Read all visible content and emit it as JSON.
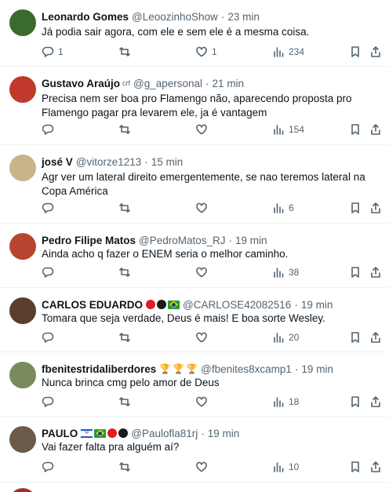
{
  "tweets": [
    {
      "name": "Leonardo Gomes",
      "handle": "@LeoozinhoShow",
      "sep": "·",
      "time": "23 min",
      "text": "Já podia sair agora, com ele e sem ele é a mesma coisa.",
      "replies": "1",
      "retweets": "",
      "likes": "1",
      "views": "234",
      "avatar_color": "#3a6b2e"
    },
    {
      "name": "Gustavo Araújo",
      "badge": "crf",
      "handle": "@g_apersonal",
      "sep": "·",
      "time": "21 min",
      "text": "Precisa nem ser boa pro Flamengo não, aparecendo proposta pro Flamengo pagar pra levarem ele, ja é vantagem",
      "replies": "",
      "retweets": "",
      "likes": "",
      "views": "154",
      "avatar_color": "#c0392b"
    },
    {
      "name": "josé V",
      "handle": "@vitorze1213",
      "sep": "·",
      "time": "15 min",
      "text": "Agr ver um lateral direito emergentemente, se nao teremos lateral na Copa América",
      "replies": "",
      "retweets": "",
      "likes": "",
      "views": "6",
      "avatar_color": "#c9b48a"
    },
    {
      "name": "Pedro Filipe Matos",
      "handle": "@PedroMatos_RJ",
      "sep": "·",
      "time": "19 min",
      "text": "Ainda acho q fazer o ENEM seria o melhor caminho.",
      "replies": "",
      "retweets": "",
      "likes": "",
      "views": "38",
      "avatar_color": "#b8452f"
    },
    {
      "name": "CARLOS EDUARDO",
      "handle": "@CARLOSE42082516",
      "sep": "·",
      "time": "19 min",
      "text": "Tomara que seja verdade, Deus é mais! E boa sorte Wesley.",
      "replies": "",
      "retweets": "",
      "likes": "",
      "views": "20",
      "avatar_color": "#5a3d2b"
    },
    {
      "name": "fbenitestridaliberdores",
      "handle": "@fbenites8xcamp1",
      "sep": "·",
      "time": "19 min",
      "text": "Nunca brinca cmg pelo amor de Deus",
      "replies": "",
      "retweets": "",
      "likes": "",
      "views": "18",
      "avatar_color": "#7a8a5a"
    },
    {
      "name": "PAULO",
      "handle": "@Paulofla81rj",
      "sep": "·",
      "time": "19 min",
      "text": "Vai fazer falta pra alguém aí?",
      "replies": "",
      "retweets": "",
      "likes": "",
      "views": "10",
      "avatar_color": "#6b5a4a"
    }
  ],
  "icons": {
    "reply": "reply-icon",
    "retweet": "retweet-icon",
    "like": "heart-icon",
    "views": "views-icon",
    "bookmark": "bookmark-icon",
    "share": "share-icon",
    "trophy": "trophy-icon"
  },
  "colors": {
    "text": "#0f1419",
    "secondary": "#536471",
    "divider": "#eff3f4",
    "red_dot": "#e01b24",
    "black_dot": "#1a1a1a"
  }
}
